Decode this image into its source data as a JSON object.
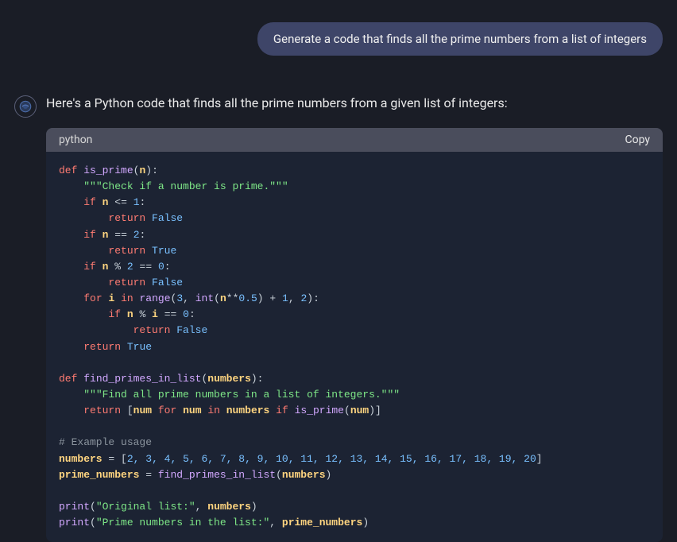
{
  "user_message": "Generate a code that finds all the prime numbers from a list of integers",
  "assistant_intro": "Here's a Python code that finds all the prime numbers from a given list of integers:",
  "code_block": {
    "language": "python",
    "copy_label": "Copy"
  },
  "code": {
    "l1_def": "def",
    "l1_fn": "is_prime",
    "l1_param": "n",
    "l2_doc": "\"\"\"Check if a number is prime.\"\"\"",
    "l3_if": "if",
    "l3_n": "n",
    "l3_num": "1",
    "l4_ret": "return",
    "l4_false": "False",
    "l5_if": "if",
    "l5_n": "n",
    "l5_num": "2",
    "l6_ret": "return",
    "l6_true": "True",
    "l7_if": "if",
    "l7_n": "n",
    "l7_num2": "2",
    "l7_num0": "0",
    "l8_ret": "return",
    "l8_false": "False",
    "l9_for": "for",
    "l9_i": "i",
    "l9_in": "in",
    "l9_range": "range",
    "l9_3": "3",
    "l9_int": "int",
    "l9_n": "n",
    "l9_05": "0.5",
    "l9_1": "1",
    "l9_2": "2",
    "l10_if": "if",
    "l10_n": "n",
    "l10_i": "i",
    "l10_0": "0",
    "l11_ret": "return",
    "l11_false": "False",
    "l12_ret": "return",
    "l12_true": "True",
    "l14_def": "def",
    "l14_fn": "find_primes_in_list",
    "l14_param": "numbers",
    "l15_doc": "\"\"\"Find all prime numbers in a list of integers.\"\"\"",
    "l16_ret": "return",
    "l16_num": "num",
    "l16_for": "for",
    "l16_num2": "num",
    "l16_in": "in",
    "l16_numbers": "numbers",
    "l16_if": "if",
    "l16_isprime": "is_prime",
    "l16_num3": "num",
    "l18_comment": "# Example usage",
    "l19_numbers": "numbers",
    "l19_list": "2, 3, 4, 5, 6, 7, 8, 9, 10, 11, 12, 13, 14, 15, 16, 17, 18, 19, 20",
    "l20_prime": "prime_numbers",
    "l20_fn": "find_primes_in_list",
    "l20_arg": "numbers",
    "l22_print": "print",
    "l22_str": "\"Original list:\"",
    "l22_arg": "numbers",
    "l23_print": "print",
    "l23_str": "\"Prime numbers in the list:\"",
    "l23_arg": "prime_numbers"
  }
}
